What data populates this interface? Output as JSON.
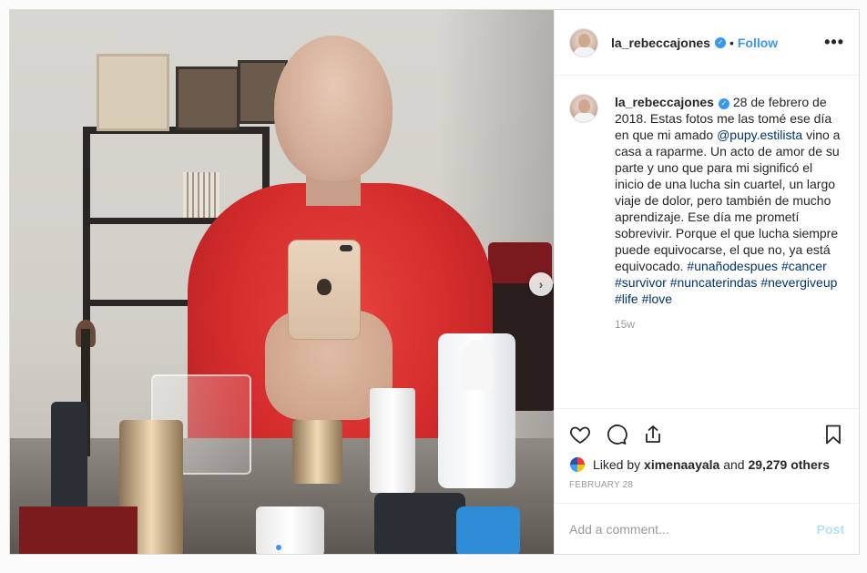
{
  "header": {
    "username": "la_rebeccajones",
    "separator": "•",
    "follow_label": "Follow",
    "more_label": "•••"
  },
  "caption": {
    "username": "la_rebeccajones",
    "text_before": " 28 de febrero de 2018. Estas fotos me las tomé ese día en que mi amado ",
    "mention": "@pupy.estilista",
    "text_after": " vino a casa a raparme. Un acto de amor de su parte y uno que para mi significó el inicio de una lucha sin cuartel, un largo viaje de dolor, pero también de mucho aprendizaje. Ese día me prometí sobrevivir. Porque el que lucha siempre puede equivocarse, el que no, ya está equivocado. ",
    "hashtags": [
      "#unañodespues",
      "#cancer",
      "#survivor",
      "#nuncaterindas",
      "#nevergiveup",
      "#life",
      "#love"
    ],
    "age": "15w"
  },
  "actions": {
    "like_icon": "heart-icon",
    "comment_icon": "comment-icon",
    "share_icon": "share-icon",
    "save_icon": "bookmark-icon"
  },
  "likes": {
    "prefix": "Liked by ",
    "user": "ximenaayala",
    "middle": " and ",
    "count": "29,279 others"
  },
  "date": "FEBRUARY 28",
  "comment_box": {
    "placeholder": "Add a comment...",
    "post_label": "Post"
  },
  "carousel": {
    "next_label": "›",
    "slides": 2,
    "active": 1
  },
  "colors": {
    "accent": "#3897f0",
    "link": "#003569",
    "muted": "#999999",
    "post_disabled": "#b2dffc"
  }
}
